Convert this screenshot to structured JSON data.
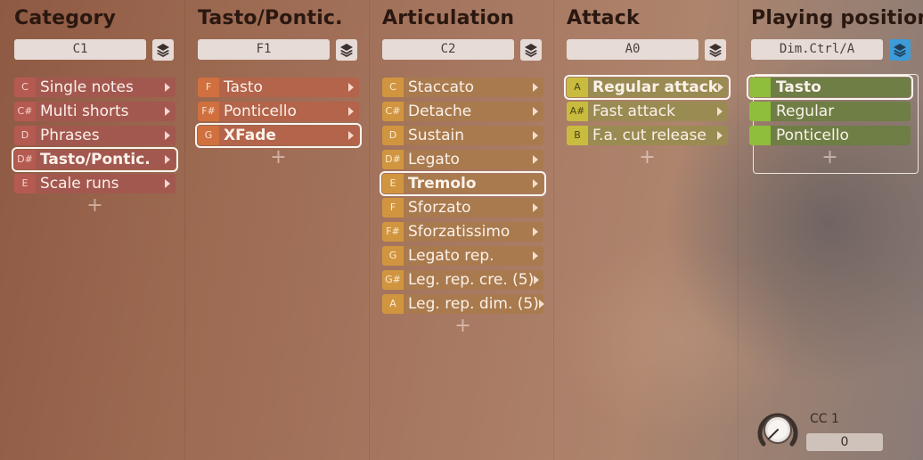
{
  "columns": {
    "category": {
      "title": "Category",
      "trigger": "C1",
      "items": [
        {
          "key": "C",
          "label": "Single notes"
        },
        {
          "key": "C#",
          "label": "Multi shorts"
        },
        {
          "key": "D",
          "label": "Phrases"
        },
        {
          "key": "D#",
          "label": "Tasto/Pontic."
        },
        {
          "key": "E",
          "label": "Scale runs"
        }
      ]
    },
    "tasto_pontic": {
      "title": "Tasto/Pontic.",
      "trigger": "F1",
      "items": [
        {
          "key": "F",
          "label": "Tasto"
        },
        {
          "key": "F#",
          "label": "Ponticello"
        },
        {
          "key": "G",
          "label": "XFade"
        }
      ]
    },
    "articulation": {
      "title": "Articulation",
      "trigger": "C2",
      "items": [
        {
          "key": "C",
          "label": "Staccato"
        },
        {
          "key": "C#",
          "label": "Detache"
        },
        {
          "key": "D",
          "label": "Sustain"
        },
        {
          "key": "D#",
          "label": "Legato"
        },
        {
          "key": "E",
          "label": "Tremolo"
        },
        {
          "key": "F",
          "label": "Sforzato"
        },
        {
          "key": "F#",
          "label": "Sforzatissimo"
        },
        {
          "key": "G",
          "label": "Legato rep."
        },
        {
          "key": "G#",
          "label": "Leg. rep. cre. (5)"
        },
        {
          "key": "A",
          "label": "Leg. rep. dim. (5)"
        }
      ]
    },
    "attack": {
      "title": "Attack",
      "trigger": "A0",
      "items": [
        {
          "key": "A",
          "label": "Regular attack"
        },
        {
          "key": "A#",
          "label": "Fast attack"
        },
        {
          "key": "B",
          "label": "F.a. cut release"
        }
      ]
    },
    "playing_position": {
      "title": "Playing position",
      "trigger": "Dim.Ctrl/A",
      "items": [
        {
          "key": "",
          "label": "Tasto"
        },
        {
          "key": "",
          "label": "Regular"
        },
        {
          "key": "",
          "label": "Ponticello"
        }
      ]
    }
  },
  "add_symbol": "+",
  "cc": {
    "label": "CC 1",
    "value": "0"
  }
}
